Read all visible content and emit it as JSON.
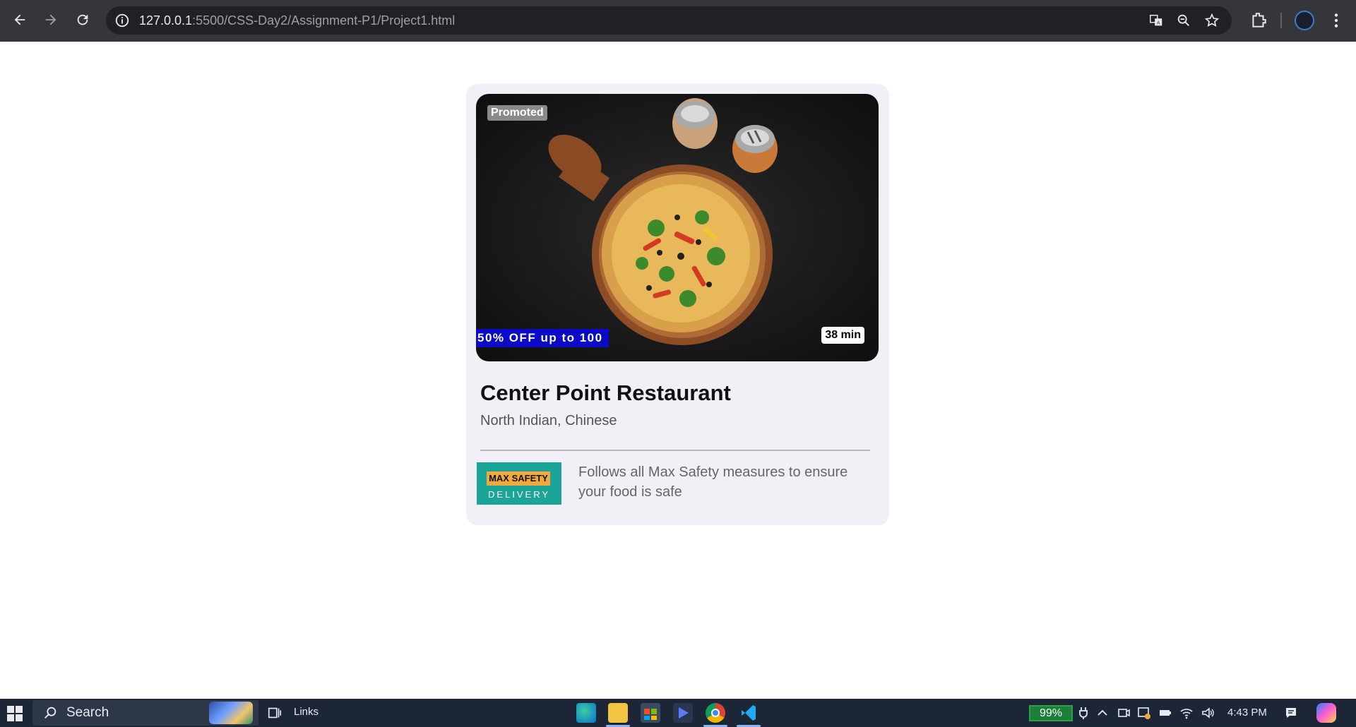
{
  "browser": {
    "url_host": "127.0.0.1",
    "url_path": ":5500/CSS-Day2/Assignment-P1/Project1.html",
    "icons": [
      "back-icon",
      "forward-icon",
      "reload-icon",
      "site-info-icon",
      "translate-icon",
      "zoom-icon",
      "bookmark-star-icon",
      "extensions-icon",
      "profile-avatar",
      "menu-icon"
    ]
  },
  "card": {
    "promoted_label": "Promoted",
    "offer_label": "50% OFF up to 100",
    "eta_label": "38 min",
    "restaurant_name": "Center Point Restaurant",
    "cuisines": "North Indian, Chinese",
    "badge_top": "MAX SAFETY",
    "badge_bottom": "DELIVERY",
    "safety_text": "Follows all Max Safety measures to ensure your food is safe",
    "colors": {
      "card_bg": "#f1f0f6",
      "offer_bg": "#0a0ac8",
      "badge_bg": "#1ba598",
      "badge_accent": "#f2a93b"
    }
  },
  "taskbar": {
    "search_label": "Search",
    "links_label": "Links",
    "battery_label": "99%",
    "clock": "4:43 PM",
    "apps": [
      "edge-icon",
      "file-explorer-icon",
      "store-icon",
      "app-icon",
      "chrome-icon",
      "vscode-icon"
    ]
  }
}
